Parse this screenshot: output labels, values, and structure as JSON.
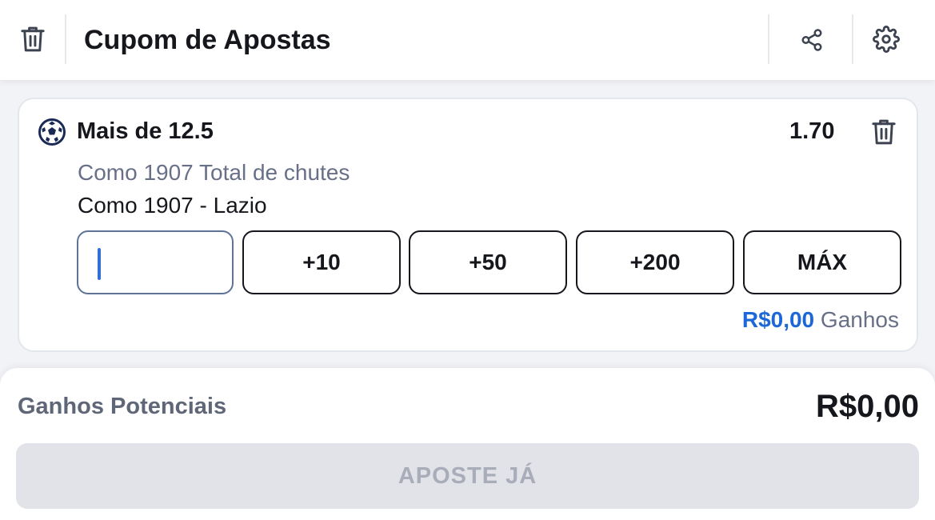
{
  "header": {
    "title": "Cupom de Apostas",
    "icons": {
      "clear_all": "trash-icon",
      "share": "share-icon",
      "settings": "gear-icon"
    }
  },
  "selection": {
    "sport_icon": "soccer-ball-icon",
    "title": "Mais de 12.5",
    "odds": "1.70",
    "market": "Como 1907 Total de chutes",
    "event": "Como 1907 - Lazio",
    "stake_value": "",
    "quick_stakes": [
      "+10",
      "+50",
      "+200",
      "MÁX"
    ],
    "winnings_amount": "R$0,00",
    "winnings_label": "Ganhos"
  },
  "footer": {
    "potential_label": "Ganhos Potenciais",
    "potential_value": "R$0,00",
    "bet_button": "APOSTE JÁ"
  },
  "colors": {
    "accent_blue": "#1d67d8",
    "text_dark": "#15171c",
    "text_muted": "#687088",
    "disabled_bg": "#e2e3e8",
    "disabled_text": "#a9adb9"
  }
}
